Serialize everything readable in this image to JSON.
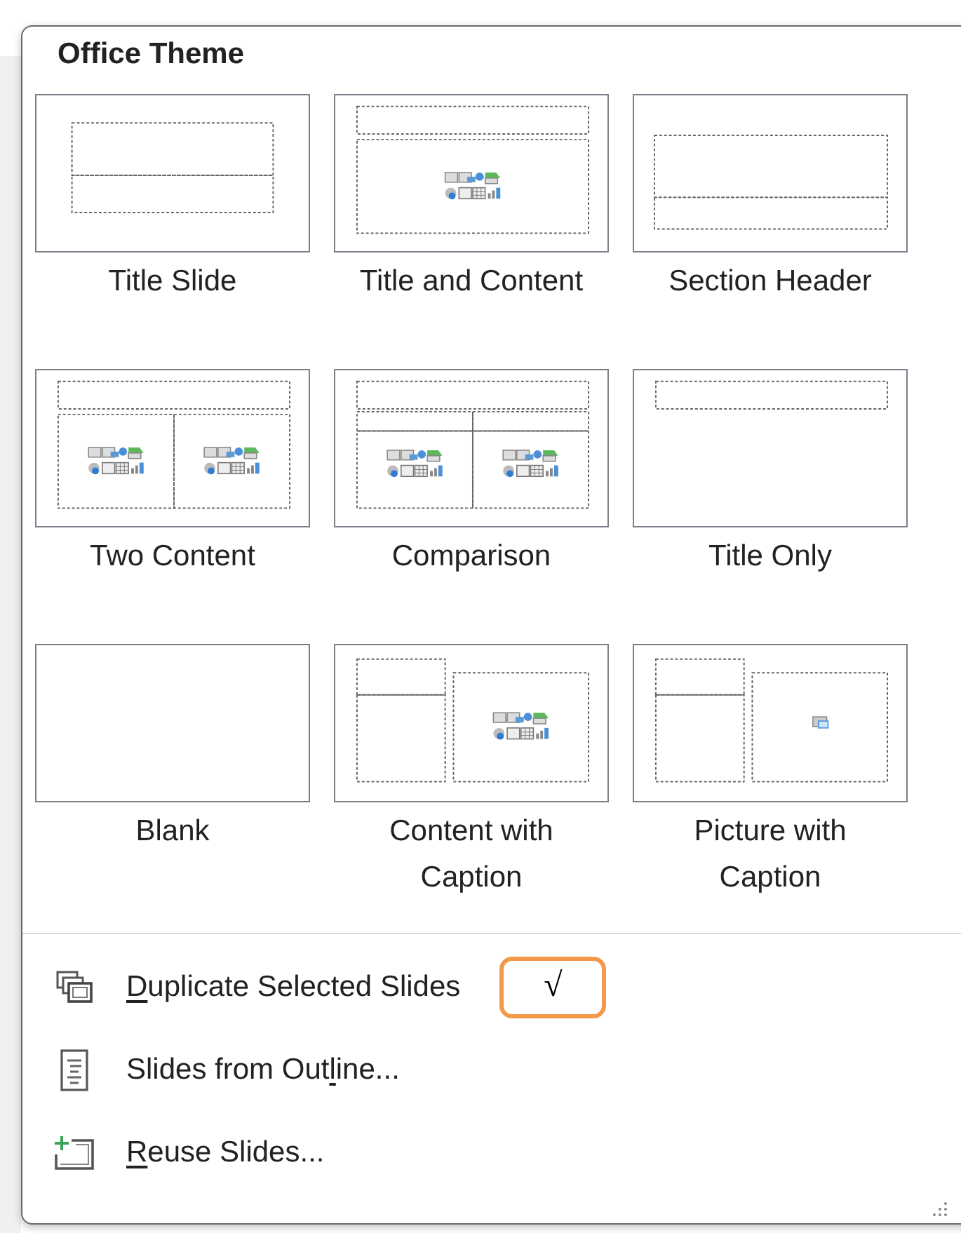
{
  "panel": {
    "title": "Office Theme"
  },
  "layouts": [
    {
      "label": "Title Slide",
      "kind": "title"
    },
    {
      "label": "Title and Content",
      "kind": "title-content"
    },
    {
      "label": "Section Header",
      "kind": "section"
    },
    {
      "label": "Two Content",
      "kind": "two-content"
    },
    {
      "label": "Comparison",
      "kind": "comparison"
    },
    {
      "label": "Title Only",
      "kind": "title-only"
    },
    {
      "label": "Blank",
      "kind": "blank"
    },
    {
      "label": "Content with Caption",
      "kind": "content-caption"
    },
    {
      "label": "Picture with Caption",
      "kind": "picture-caption"
    }
  ],
  "menu": [
    {
      "kind": "duplicate",
      "access_key": "D",
      "text_after": "uplicate Selected Slides",
      "annotation": "√"
    },
    {
      "kind": "outline",
      "text_before": "Slides from Out",
      "access_key": "l",
      "text_after": "ine..."
    },
    {
      "kind": "reuse",
      "access_key": "R",
      "text_after": "euse Slides..."
    }
  ]
}
